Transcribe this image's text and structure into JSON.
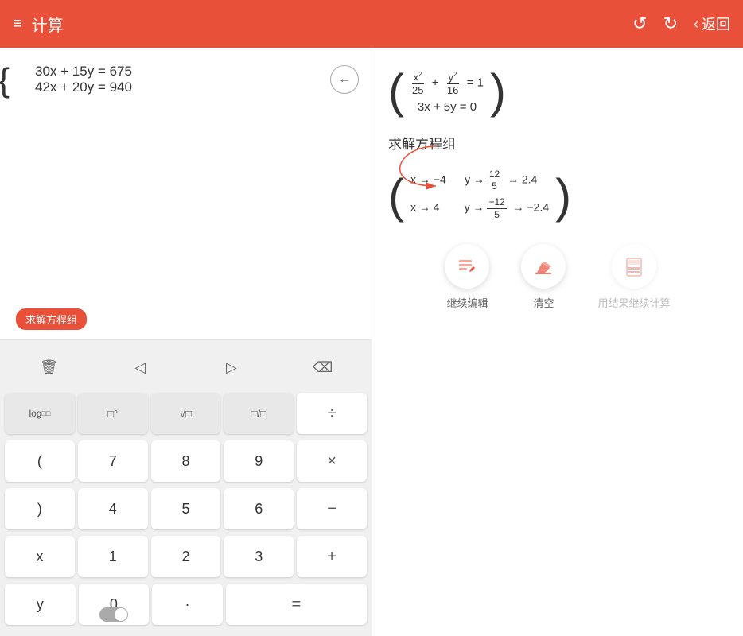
{
  "header": {
    "menu_icon": "≡",
    "title": "计算",
    "undo_icon": "↺",
    "redo_icon": "↻",
    "back_icon": "‹",
    "back_label": "返回"
  },
  "input": {
    "equation1": "30x + 15y = 675",
    "equation2": "42x + 20y = 940",
    "solve_tag": "求解方程组",
    "backspace_icon": "←"
  },
  "result": {
    "solve_label": "求解方程组",
    "solution_row1": "x → −4    y → 12/5 → 2.4",
    "solution_row2": "x → 4    y → −12/5 → −2.4"
  },
  "keyboard": {
    "nav_row": [
      "🗑",
      "◁",
      "▷",
      "⌫"
    ],
    "row1": [
      "log□□",
      "□°",
      "√□",
      "□/□",
      "÷"
    ],
    "row2": [
      "(",
      "7",
      "8",
      "9",
      "×"
    ],
    "row3": [
      ")",
      "4",
      "5",
      "6",
      "−"
    ],
    "row4": [
      "x",
      "1",
      "2",
      "3",
      "+"
    ],
    "row5": [
      "y",
      "0",
      "·",
      "="
    ]
  },
  "actions": {
    "edit_label": "继续编辑",
    "clear_label": "清空",
    "calc_label": "用结果继续计算"
  },
  "colors": {
    "accent": "#e8503a",
    "bg": "#f5f5f5",
    "key_bg": "#ffffff",
    "key_special_bg": "#e8e8e8"
  }
}
